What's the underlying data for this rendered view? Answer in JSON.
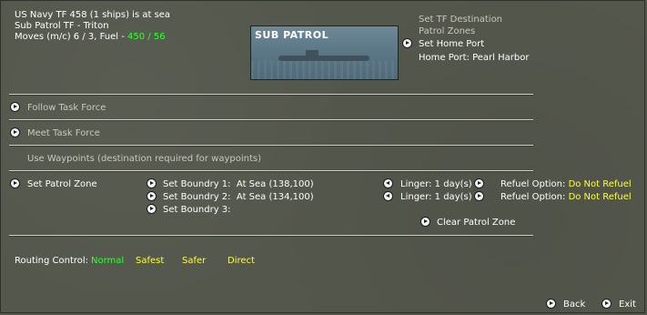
{
  "header": {
    "line1": "US Navy TF 458 (1 ships) is at sea",
    "line2": "Sub Patrol TF - Triton",
    "moves_label": "Moves (m/c) 6 / 3, Fuel - ",
    "fuel_value": "450 / 56"
  },
  "image_title": "SUB PATROL",
  "destination": {
    "set_tf_destination": "Set TF Destination",
    "patrol_zones": "Patrol Zones",
    "set_home_port": "Set Home Port",
    "home_port": "Home Port: Pearl Harbor"
  },
  "options": {
    "follow": "Follow Task Force",
    "meet": "Meet Task Force",
    "waypoints": "Use Waypoints  (destination required for waypoints)"
  },
  "patrol": {
    "set_zone": "Set Patrol Zone",
    "boundaries": [
      {
        "label": "Set Boundry 1:",
        "value": "At Sea  (138,100)"
      },
      {
        "label": "Set Boundry 2:",
        "value": "At Sea  (134,100)"
      },
      {
        "label": "Set Boundry 3:",
        "value": ""
      }
    ],
    "linger": [
      "Linger: 1 day(s)",
      "Linger: 1 day(s)"
    ],
    "refuel_label": "Refuel Option:",
    "refuel_values": [
      "Do Not Refuel",
      "Do Not Refuel"
    ],
    "clear": "Clear Patrol Zone"
  },
  "routing": {
    "label": "Routing Control:",
    "normal": "Normal",
    "safest": "Safest",
    "safer": "Safer",
    "direct": "Direct"
  },
  "footer": {
    "back": "Back",
    "exit": "Exit"
  },
  "colors": {
    "background": "#54574c",
    "green": "#33ff33",
    "yellow": "#ffff33",
    "grey_text": "#c8c8c0"
  },
  "icons": {
    "arrow_button": "arrow-right-icon",
    "arrow_left_button": "arrow-left-icon"
  }
}
